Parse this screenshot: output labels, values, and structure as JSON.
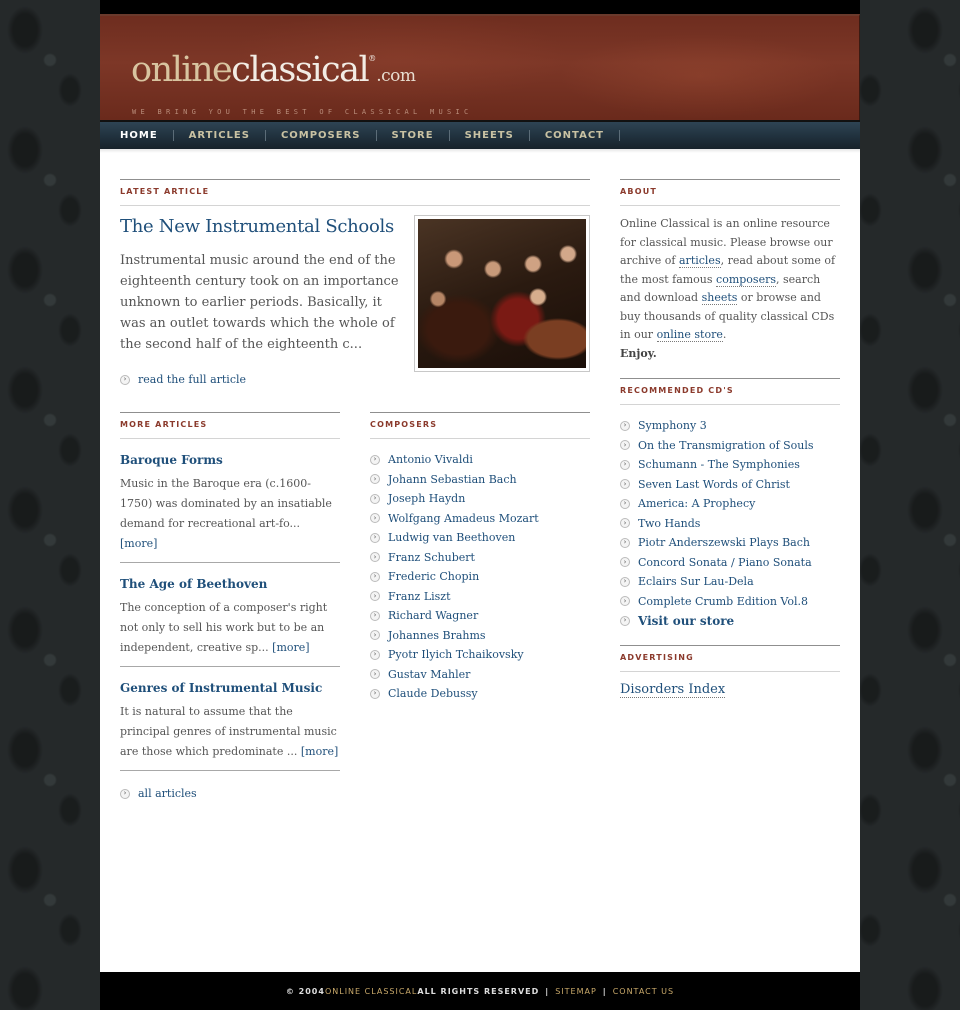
{
  "site": {
    "logo_online": "online",
    "logo_classical": "classical",
    "logo_reg": "®",
    "logo_com": ".com",
    "tagline": "WE BRING YOU THE BEST OF CLASSICAL MUSIC"
  },
  "nav": [
    {
      "label": "HOME",
      "active": true
    },
    {
      "label": "ARTICLES"
    },
    {
      "label": "COMPOSERS"
    },
    {
      "label": "STORE"
    },
    {
      "label": "SHEETS"
    },
    {
      "label": "CONTACT"
    }
  ],
  "latest": {
    "heading": "LATEST ARTICLE",
    "title": "The New Instrumental Schools",
    "excerpt": "Instrumental music around the end of the eighteenth century took on an importance unknown to earlier periods. Basically, it was an outlet towards which the whole of the second half of the eighteenth c...",
    "read_more": "read the full article",
    "image_alt": "baroque musicians painting"
  },
  "more_articles": {
    "heading": "MORE ARTICLES",
    "items": [
      {
        "title": "Baroque Forms",
        "excerpt": "Music in the Baroque era (c.1600-1750) was dominated by an insatiable demand for recreational art-fo...",
        "more": "[more]"
      },
      {
        "title": "The Age of Beethoven",
        "excerpt": "The conception of a composer's right not only to sell his work but to be an independent, creative sp...",
        "more": "[more]"
      },
      {
        "title": "Genres of Instrumental Music",
        "excerpt": "It is natural to assume that the principal genres of instrumental music are those which predominate ...",
        "more": "[more]"
      }
    ],
    "all_link": "all articles"
  },
  "composers": {
    "heading": "COMPOSERS",
    "items": [
      "Antonio Vivaldi",
      "Johann Sebastian Bach",
      "Joseph Haydn",
      "Wolfgang Amadeus Mozart",
      "Ludwig van Beethoven",
      "Franz Schubert",
      "Frederic Chopin",
      "Franz Liszt",
      "Richard Wagner",
      "Johannes Brahms",
      "Pyotr Ilyich Tchaikovsky",
      "Gustav Mahler",
      "Claude Debussy"
    ]
  },
  "about": {
    "heading": "ABOUT",
    "text_1": "Online Classical is an online resource for classical music. Please browse our archive of ",
    "link_articles": "articles",
    "text_2": ", read about some of the most famous ",
    "link_composers": "composers",
    "text_3": ", search and download ",
    "link_sheets": "sheets",
    "text_4": " or browse and buy thousands of quality classical CDs in our ",
    "link_store": "online store",
    "text_5": ".",
    "enjoy": "Enjoy."
  },
  "recommended": {
    "heading": "RECOMMENDED CD'S",
    "items": [
      "Symphony 3",
      "On the Transmigration of Souls",
      "Schumann - The Symphonies",
      "Seven Last Words of Christ",
      "America: A Prophecy",
      "Two Hands",
      "Piotr Anderszewski Plays Bach",
      "Concord Sonata / Piano Sonata",
      "Eclairs Sur Lau-Dela",
      "Complete Crumb Edition Vol.8"
    ],
    "store_link": "Visit our store"
  },
  "advertising": {
    "heading": "ADVERTISING",
    "link": "Disorders Index"
  },
  "footer": {
    "copyright": "© 2004 ",
    "brand": "ONLINE CLASSICAL",
    "rights": " ALL RIGHTS RESERVED",
    "sep": "|",
    "sitemap": "SITEMAP",
    "contact": "CONTACT US"
  },
  "icons": {
    "bullet": "arrow-circle-icon",
    "bullet_glyph": "›"
  }
}
